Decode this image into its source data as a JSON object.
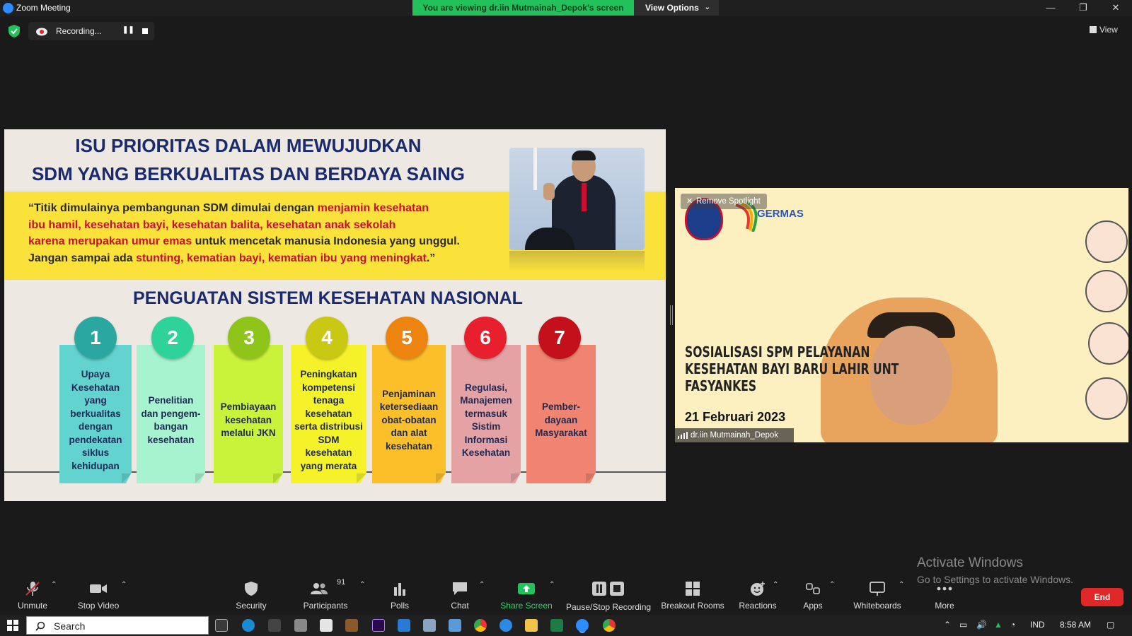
{
  "window": {
    "title": "Zoom Meeting",
    "share_banner": "You are viewing dr.iin Mutmainah_Depok's screen",
    "view_options": "View Options",
    "controls": {
      "minimize": "—",
      "restore": "❐",
      "close": "✕"
    }
  },
  "recording": {
    "label": "Recording..."
  },
  "view_label": "View",
  "slide": {
    "title_line1": "ISU PRIORITAS DALAM MEWUJUDKAN",
    "title_line2": "SDM YANG BERKUALITAS DAN BERDAYA SAING",
    "quote": [
      [
        {
          "t": "“Titik dimulainya pembangunan SDM dimulai dengan ",
          "red": false
        },
        {
          "t": "menjamin kesehatan",
          "red": true
        }
      ],
      [
        {
          "t": " ibu hamil, kesehatan bayi, kesehatan balita, kesehatan anak sekolah",
          "red": true
        }
      ],
      [
        {
          "t": "karena merupakan umur emas",
          "red": true
        },
        {
          "t": " untuk mencetak manusia Indonesia yang unggul.",
          "red": false
        }
      ],
      [
        {
          "t": "Jangan  sampai ada ",
          "red": false
        },
        {
          "t": "stunting, kematian bayi, kematian  ibu yang meningkat",
          "red": true
        },
        {
          "t": ".”",
          "red": false
        }
      ]
    ],
    "section_title": "PENGUATAN SISTEM KESEHATAN NASIONAL",
    "pillars": [
      {
        "num": "1",
        "text": "Upaya Kesehatan yang berkualitas dengan pendekatan siklus kehidupan",
        "circle": "#2aa7a0",
        "fill": "#63d3cf"
      },
      {
        "num": "2",
        "text": "Penelitian dan pengem-bangan kesehatan",
        "circle": "#2ed39a",
        "fill": "#a7f2cf"
      },
      {
        "num": "3",
        "text": "Pembiayaan kesehatan melalui JKN",
        "circle": "#8fc51a",
        "fill": "#c9f23a"
      },
      {
        "num": "4",
        "text": "Peningkatan kompetensi tenaga kesehatan serta distribusi SDM kesehatan yang merata",
        "circle": "#c9c812",
        "fill": "#f6f22a"
      },
      {
        "num": "5",
        "text": "Penjaminan ketersediaan obat-obatan dan alat kesehatan",
        "circle": "#ee8410",
        "fill": "#fbbf2a"
      },
      {
        "num": "6",
        "text": "Regulasi, Manajemen termasuk Sistim Informasi Kesehatan",
        "circle": "#e8202e",
        "fill": "#e5a2a4"
      },
      {
        "num": "7",
        "text": "Pember-dayaan Masyarakat",
        "circle": "#c4101a",
        "fill": "#f08470"
      }
    ]
  },
  "video": {
    "spotlight_label": "Remove Spotlight",
    "brand": "GERMAS",
    "headline_lines": [
      "SOSIALISASI SPM PELAYANAN",
      "KESEHATAN BAYI BARU LAHIR UNT",
      "FASYANKES"
    ],
    "date": "21 Februari  2023",
    "participant_name": "dr.iin Mutmainah_Depok"
  },
  "activate": {
    "line1": "Activate Windows",
    "line2": "Go to Settings to activate Windows."
  },
  "toolbar": {
    "unmute": "Unmute",
    "stop_video": "Stop Video",
    "security": "Security",
    "participants": "Participants",
    "participants_count": "91",
    "polls": "Polls",
    "chat": "Chat",
    "share_screen": "Share Screen",
    "pause_stop_recording": "Pause/Stop Recording",
    "breakout_rooms": "Breakout Rooms",
    "reactions": "Reactions",
    "apps": "Apps",
    "whiteboards": "Whiteboards",
    "more": "More",
    "end": "End"
  },
  "taskbar": {
    "search_placeholder": "Search",
    "language": "IND",
    "time": "8:58 AM"
  },
  "colors": {
    "share_green": "#23c15c",
    "end_red": "#e02828",
    "slide_title_blue": "#1a2a6e",
    "quote_red": "#c8102e",
    "quote_band": "#fbe23a"
  }
}
